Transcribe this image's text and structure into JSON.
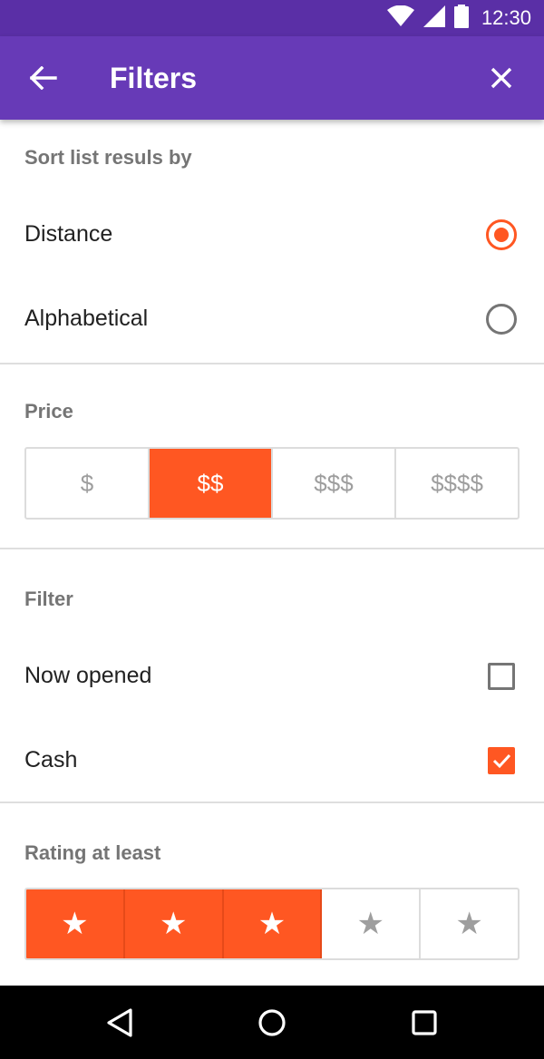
{
  "status_bar": {
    "time": "12:30",
    "icons": [
      "wifi-icon",
      "signal-icon",
      "battery-icon"
    ]
  },
  "app_bar": {
    "title": "Filters",
    "back_icon": "arrow-back-icon",
    "close_icon": "close-icon"
  },
  "sort": {
    "header": "Sort list resuls by",
    "options": [
      {
        "label": "Distance",
        "selected": true
      },
      {
        "label": "Alphabetical",
        "selected": false
      }
    ]
  },
  "price": {
    "header": "Price",
    "options": [
      {
        "label": "$",
        "selected": false
      },
      {
        "label": "$$",
        "selected": true
      },
      {
        "label": "$$$",
        "selected": false
      },
      {
        "label": "$$$$",
        "selected": false
      }
    ]
  },
  "filter": {
    "header": "Filter",
    "options": [
      {
        "label": "Now opened",
        "checked": false
      },
      {
        "label": "Cash",
        "checked": true
      }
    ]
  },
  "rating": {
    "header": "Rating at least",
    "value": 3,
    "max": 5,
    "star_glyph": "★"
  },
  "colors": {
    "primary": "#673ab7",
    "primary_dark": "#5a2fa6",
    "accent": "#ff5722"
  },
  "nav_bar": {
    "icons": [
      "back-triangle-icon",
      "home-circle-icon",
      "recents-square-icon"
    ]
  }
}
